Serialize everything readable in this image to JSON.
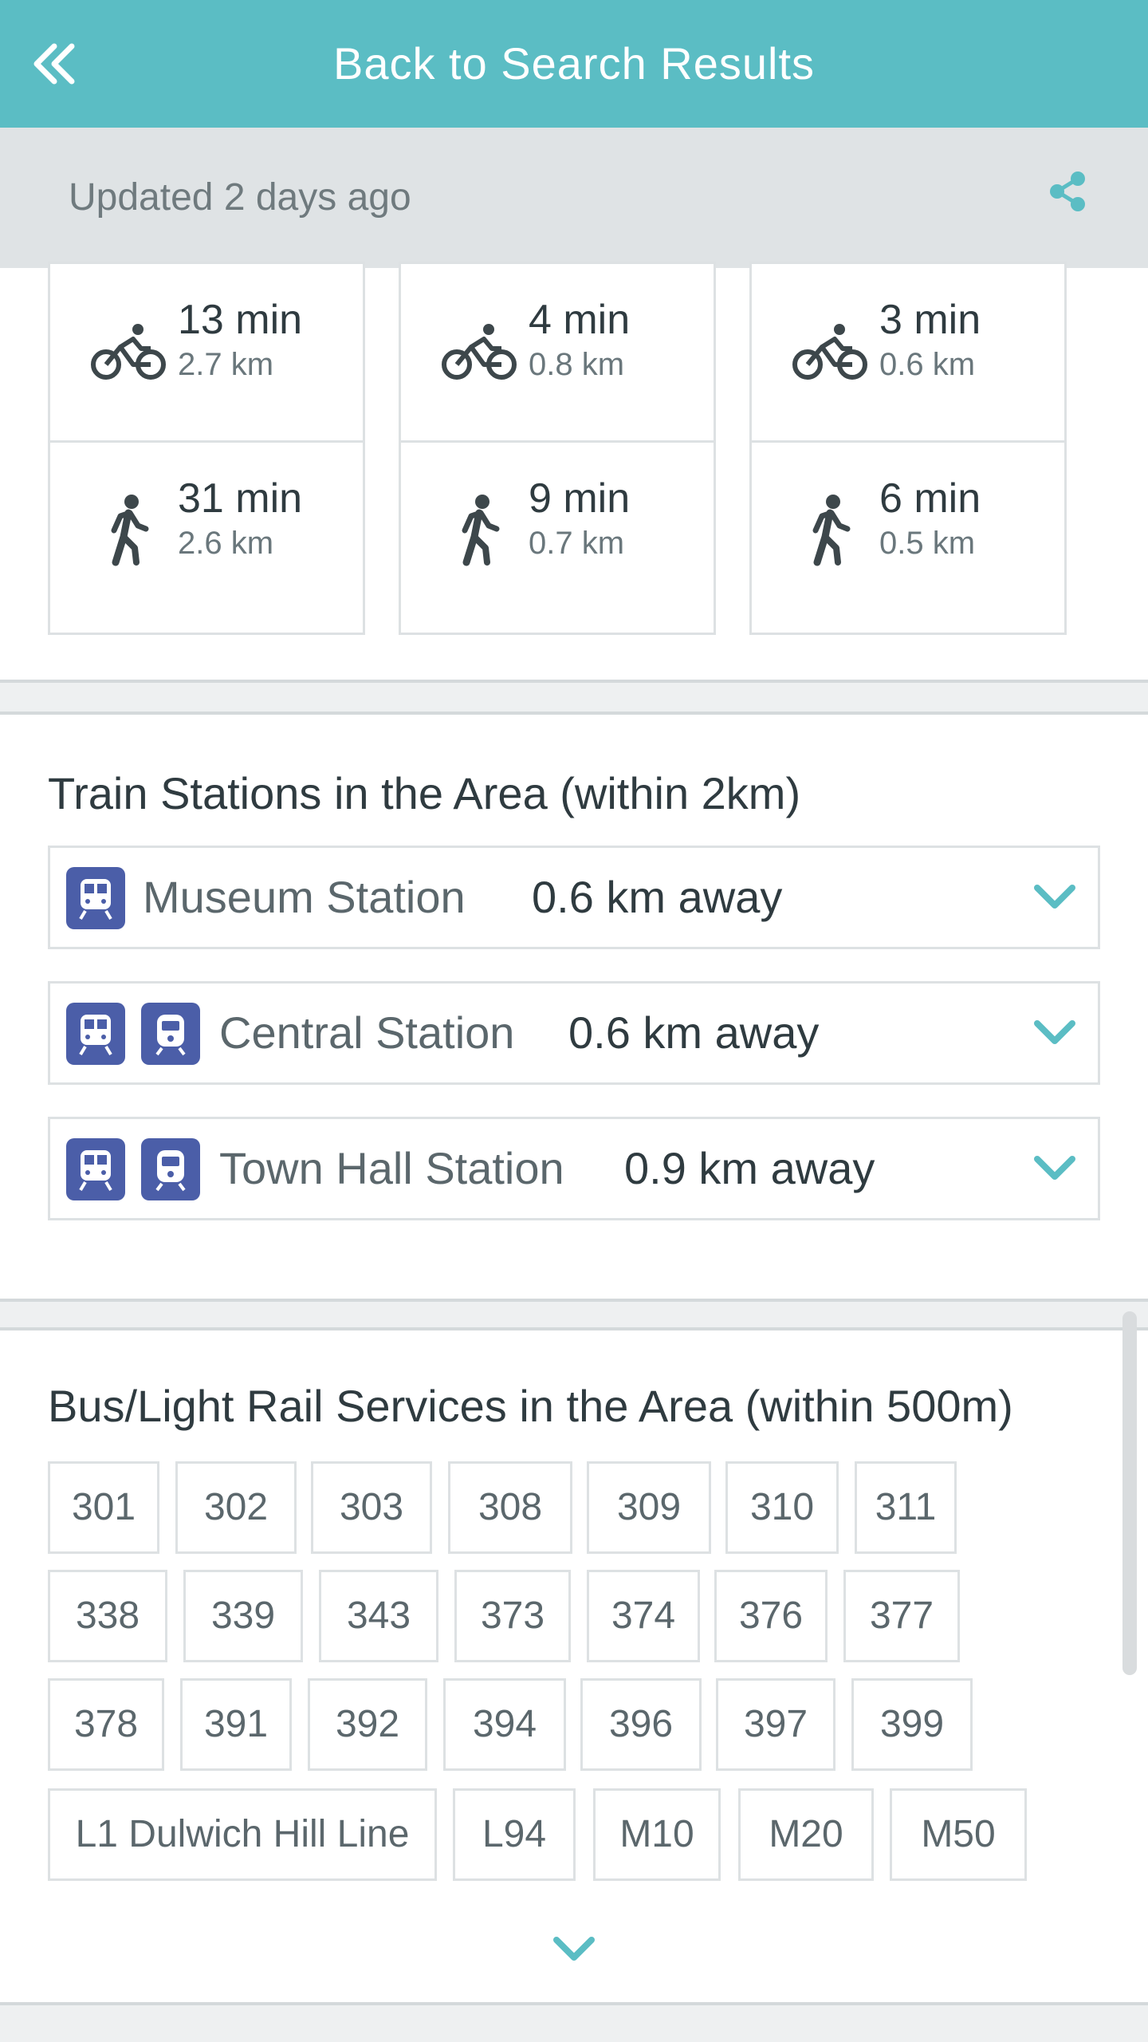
{
  "header": {
    "title": "Back to Search Results"
  },
  "updated": {
    "text": "Updated 2 days ago"
  },
  "travel": {
    "cycling": [
      {
        "time": "13 min",
        "dist": "2.7 km"
      },
      {
        "time": "4 min",
        "dist": "0.8 km"
      },
      {
        "time": "3 min",
        "dist": "0.6 km"
      }
    ],
    "walking": [
      {
        "time": "31 min",
        "dist": "2.6 km"
      },
      {
        "time": "9 min",
        "dist": "0.7 km"
      },
      {
        "time": "6 min",
        "dist": "0.5 km"
      }
    ]
  },
  "train": {
    "title": "Train Stations in the Area (within 2km)",
    "stations": [
      {
        "name": "Museum Station",
        "distance": "0.6 km away"
      },
      {
        "name": "Central Station",
        "distance": "0.6 km away"
      },
      {
        "name": "Town Hall Station",
        "distance": "0.9 km away"
      }
    ]
  },
  "bus": {
    "title": "Bus/Light Rail Services in the Area (within 500m)",
    "routes": [
      "301",
      "302",
      "303",
      "308",
      "309",
      "310",
      "311",
      "338",
      "339",
      "343",
      "373",
      "374",
      "376",
      "377",
      "378",
      "391",
      "392",
      "394",
      "396",
      "397",
      "399",
      "L1 Dulwich Hill Line",
      "L94",
      "M10",
      "M20",
      "M50"
    ]
  },
  "colors": {
    "accent": "#5bbdc4",
    "train_icon": "#4b5ea8",
    "text_dark": "#2f3b40",
    "text_muted": "#6f7a7e"
  }
}
